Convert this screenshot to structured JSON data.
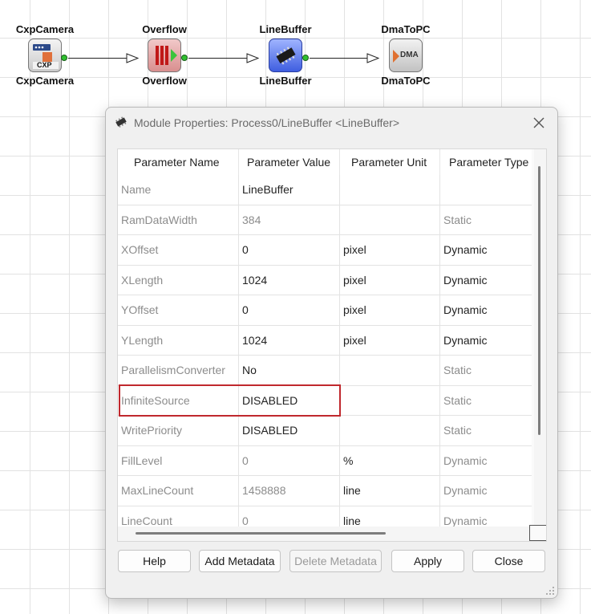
{
  "canvas": {
    "modules": [
      {
        "top_label": "CxpCamera",
        "bottom_label": "CxpCamera",
        "icon": "cxp-camera-icon",
        "icon_text": "CXP"
      },
      {
        "top_label": "Overflow",
        "bottom_label": "Overflow",
        "icon": "overflow-icon"
      },
      {
        "top_label": "LineBuffer",
        "bottom_label": "LineBuffer",
        "icon": "linebuffer-icon"
      },
      {
        "top_label": "DmaToPC",
        "bottom_label": "DmaToPC",
        "icon": "dma-icon",
        "icon_text": "DMA"
      }
    ]
  },
  "dialog": {
    "title": "Module Properties: Process0/LineBuffer <LineBuffer>",
    "columns": [
      "Parameter Name",
      "Parameter Value",
      "Parameter Unit",
      "Parameter Type"
    ],
    "rows": [
      {
        "name": "Name",
        "value": "LineBuffer",
        "unit": "",
        "type": "",
        "editable": true
      },
      {
        "name": "RamDataWidth",
        "value": "384",
        "unit": "",
        "type": "Static",
        "editable": false
      },
      {
        "name": "XOffset",
        "value": "0",
        "unit": "pixel",
        "type": "Dynamic",
        "editable": true
      },
      {
        "name": "XLength",
        "value": "1024",
        "unit": "pixel",
        "type": "Dynamic",
        "editable": true
      },
      {
        "name": "YOffset",
        "value": "0",
        "unit": "pixel",
        "type": "Dynamic",
        "editable": true
      },
      {
        "name": "YLength",
        "value": "1024",
        "unit": "pixel",
        "type": "Dynamic",
        "editable": true
      },
      {
        "name": "ParallelismConverter",
        "value": "No",
        "unit": "",
        "type": "Static",
        "editable": true
      },
      {
        "name": "InfiniteSource",
        "value": "DISABLED",
        "unit": "",
        "type": "Static",
        "editable": true
      },
      {
        "name": "WritePriority",
        "value": "DISABLED",
        "unit": "",
        "type": "Static",
        "editable": true
      },
      {
        "name": "FillLevel",
        "value": "0",
        "unit": "%",
        "type": "Dynamic",
        "editable": false
      },
      {
        "name": "MaxLineCount",
        "value": "1458888",
        "unit": "line",
        "type": "Dynamic",
        "editable": false
      },
      {
        "name": "LineCount",
        "value": "0",
        "unit": "line",
        "type": "Dynamic",
        "editable": false
      }
    ],
    "buttons": {
      "help": "Help",
      "add_metadata": "Add Metadata",
      "delete_metadata": "Delete Metadata",
      "apply": "Apply",
      "close": "Close"
    },
    "colors": {
      "highlight": "#c0282d",
      "port": "#2fbf2f"
    }
  }
}
